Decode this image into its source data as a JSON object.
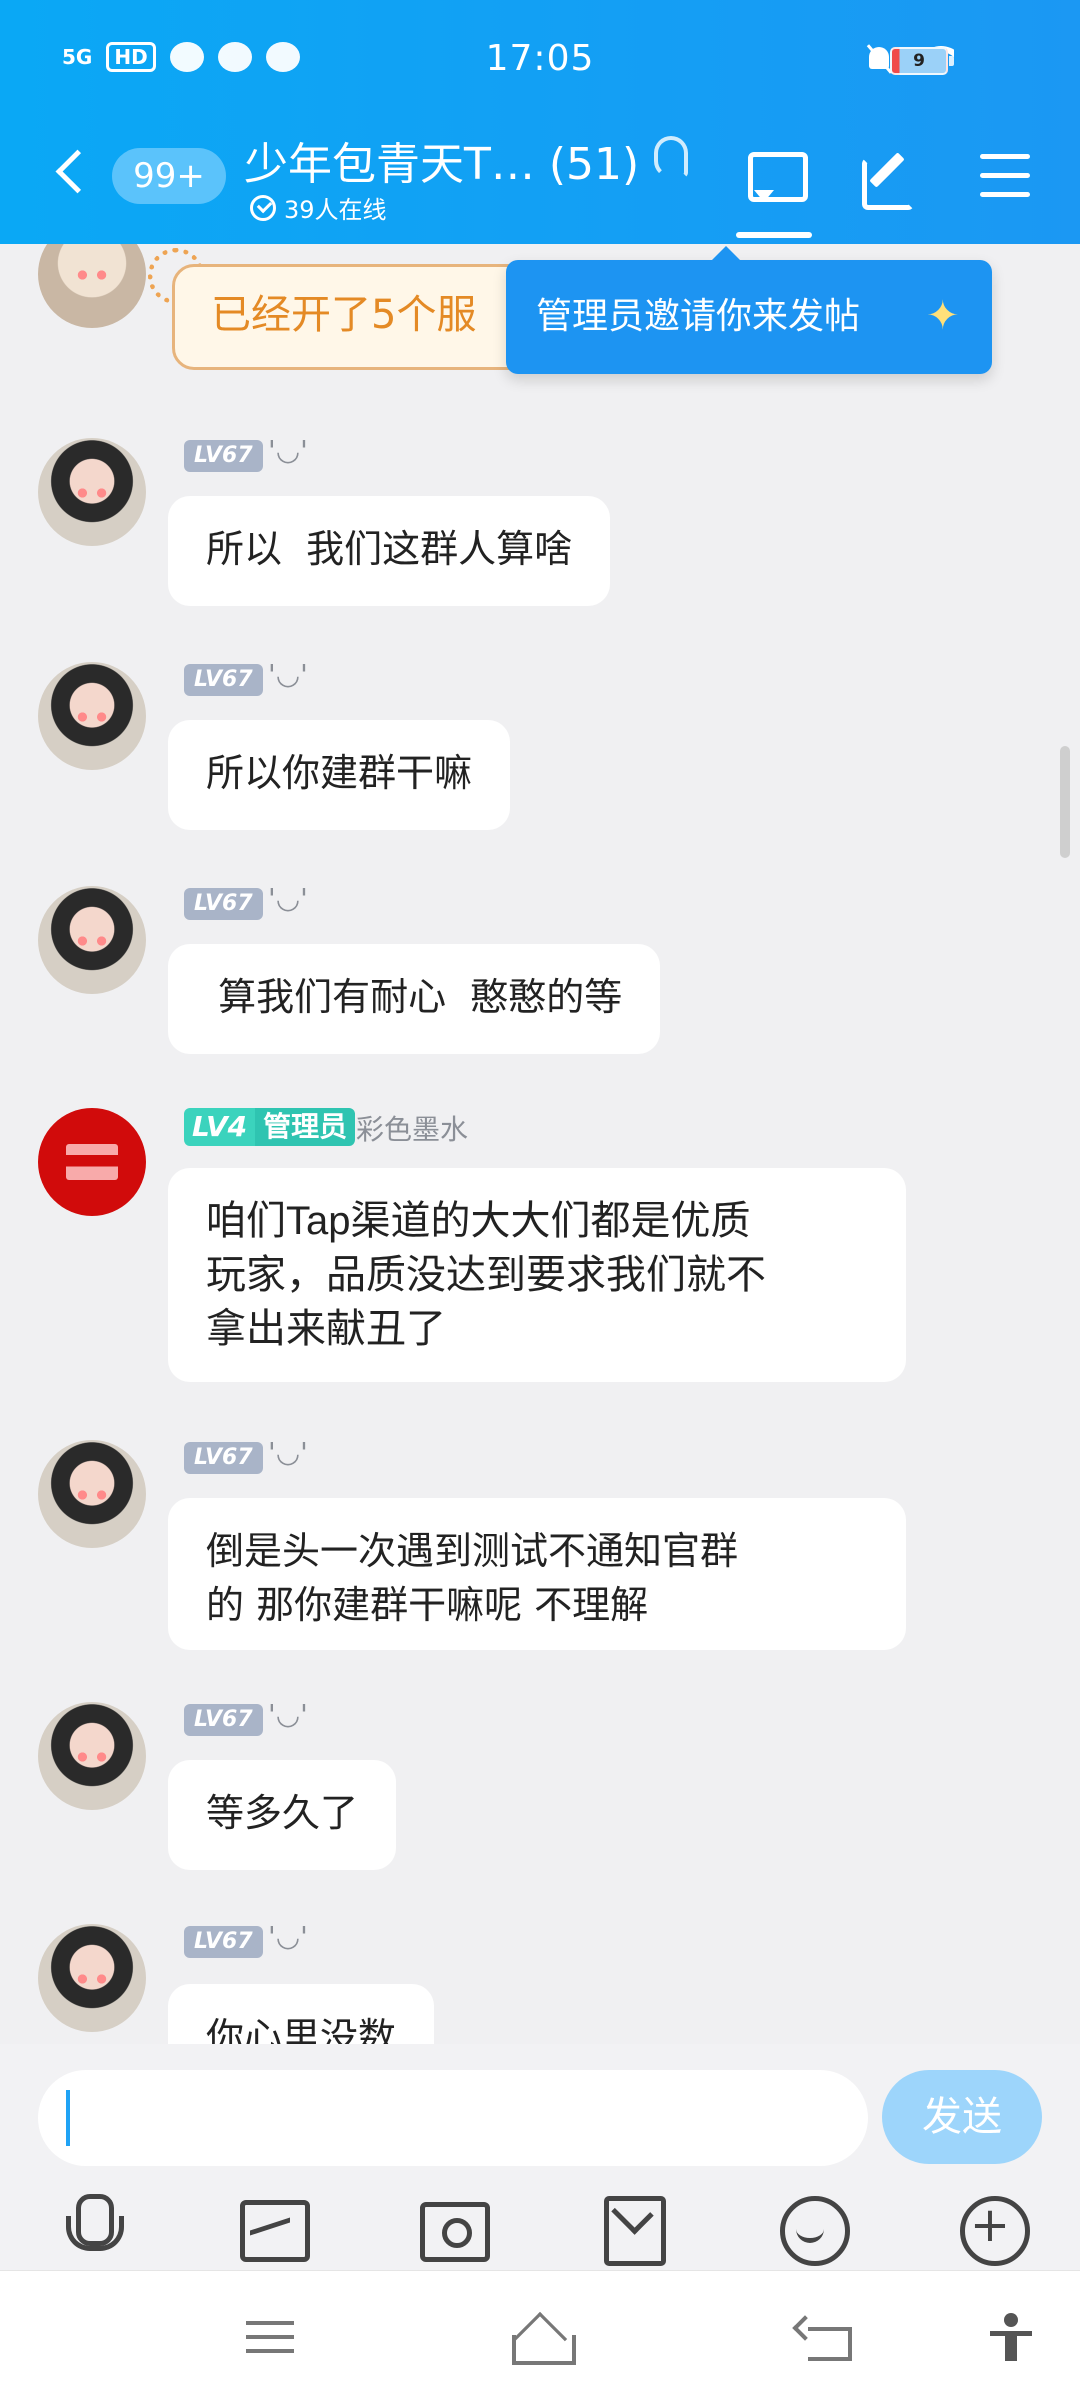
{
  "status_bar": {
    "signal": "5G",
    "hd": "HD",
    "time": "17:05",
    "battery": "9"
  },
  "header": {
    "unread": "99+",
    "title": "少年包青天T…  (51)",
    "online": "39人在线"
  },
  "tooltip": "管理员邀请你来发帖",
  "event_card": "已经开了5个服",
  "messages": [
    {
      "level": "LV67",
      "nick": "'◡'",
      "text": "所以  我们这群人算啥"
    },
    {
      "level": "LV67",
      "nick": "'◡'",
      "text": "所以你建群干嘛"
    },
    {
      "level": "LV67",
      "nick": "'◡'",
      "text": " 算我们有耐心  憨憨的等"
    },
    {
      "level": "LV4",
      "role": "管理员",
      "nick": "彩色墨水",
      "text": "咱们Tap渠道的大大们都是优质\n玩家，品质没达到要求我们就不\n拿出来献丑了"
    },
    {
      "level": "LV67",
      "nick": "'◡'",
      "text": "倒是头一次遇到测试不通知官群\n的 那你建群干嘛呢 不理解"
    },
    {
      "level": "LV67",
      "nick": "'◡'",
      "text": "等多久了"
    },
    {
      "level": "LV67",
      "nick": "'◡'",
      "text": "你心里没数"
    }
  ],
  "input": {
    "placeholder": "",
    "send_label": "发送"
  },
  "colors": {
    "header_gradient_start": "#0aa8f5",
    "accent": "#1d94f2",
    "admin_badge": "#3bd3bd"
  }
}
